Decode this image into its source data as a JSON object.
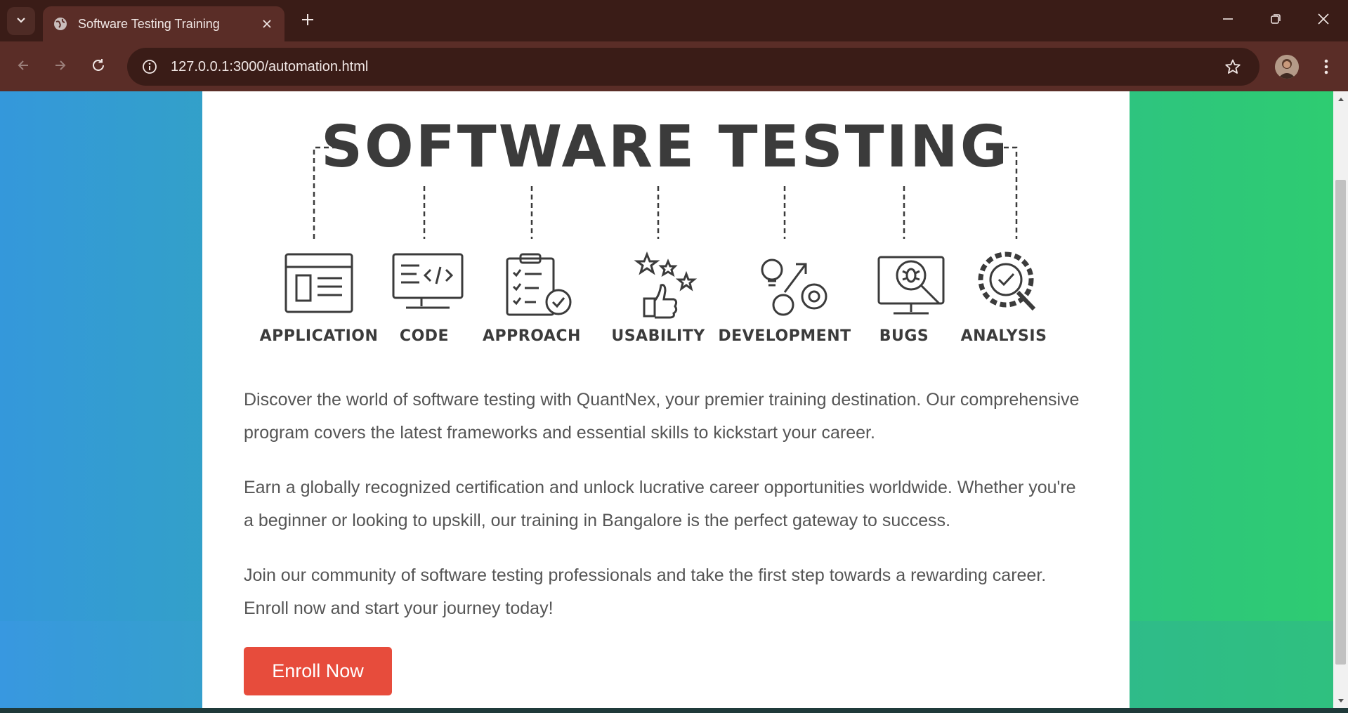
{
  "browser": {
    "tab_title": "Software Testing Training",
    "url": "127.0.0.1:3000/automation.html",
    "accent_color": "#5a2d27",
    "icons": {
      "tab_menu": "chevron-down-icon",
      "favicon": "globe-icon",
      "close": "close-icon",
      "new_tab": "plus-icon",
      "back": "arrow-left-icon",
      "forward": "arrow-right-icon",
      "reload": "reload-icon",
      "info": "info-icon",
      "star": "star-icon",
      "menu": "more-vert-icon"
    }
  },
  "hero": {
    "title": "SOFTWARE TESTING",
    "labels": [
      "APPLICATION",
      "CODE",
      "APPROACH",
      "USABILITY",
      "DEVELOPMENT",
      "BUGS",
      "ANALYSIS"
    ]
  },
  "content": {
    "paragraphs": [
      "Discover the world of software testing with QuantNex, your premier training destination. Our comprehensive program covers the latest frameworks and essential skills to kickstart your career.",
      "Earn a globally recognized certification and unlock lucrative career opportunities worldwide. Whether you're a beginner or looking to upskill, our training in Bangalore is the perfect gateway to success.",
      "Join our community of software testing professionals and take the first step towards a rewarding career. Enroll now and start your journey today!"
    ],
    "enroll_label": "Enroll Now",
    "enroll_color": "#e74c3c"
  }
}
